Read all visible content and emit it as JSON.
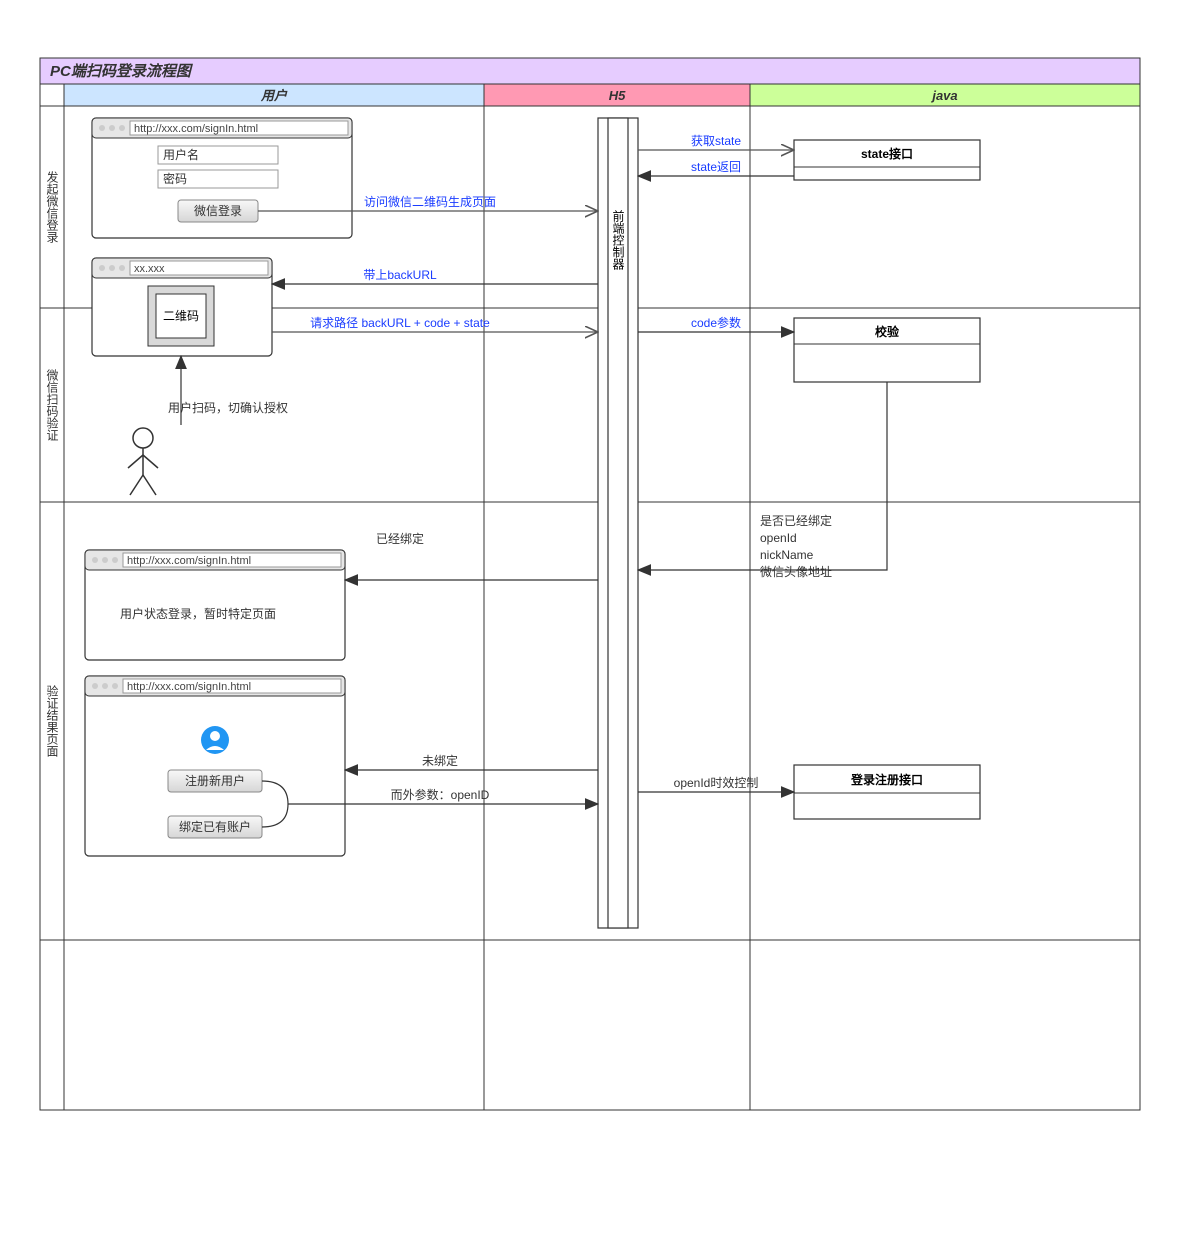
{
  "title": "PC端扫码登录流程图",
  "lanes": {
    "user": "用户",
    "h5": "H5",
    "java": "java"
  },
  "rows": {
    "r1": "发起微信登录",
    "r2": "微信扫码验证",
    "r3": "验证结果页面"
  },
  "browser1": {
    "url": "http://xxx.com/signIn.html",
    "username_label": "用户名",
    "password_label": "密码",
    "wechat_login_btn": "微信登录"
  },
  "browser2": {
    "url": "xx.xxx",
    "qr_label": "二维码"
  },
  "browser3": {
    "url": "http://xxx.com/signIn.html",
    "status_text": "用户状态登录，暂时特定页面"
  },
  "browser4": {
    "url": "http://xxx.com/signIn.html",
    "reg_btn": "注册新用户",
    "bind_btn": "绑定已有账户"
  },
  "h5_node": "前端控制器",
  "java_nodes": {
    "state": "state接口",
    "verify": "校验",
    "login": "登录注册接口"
  },
  "messages": {
    "m1": "访问微信二维码生成页面",
    "m2": "获取state",
    "m3": "state返回",
    "m4": "带上backURL",
    "m5": "请求路径 backURL + code + state",
    "m6": "code参数",
    "m7": "是否已经绑定",
    "m7b": "openId",
    "m7c": "nickName",
    "m7d": "微信头像地址",
    "m8": "已经绑定",
    "m9": "未绑定",
    "m10": "而外参数：openID",
    "m11": "openId时效控制"
  },
  "notes": {
    "scan": "用户扫码，切确认授权"
  }
}
